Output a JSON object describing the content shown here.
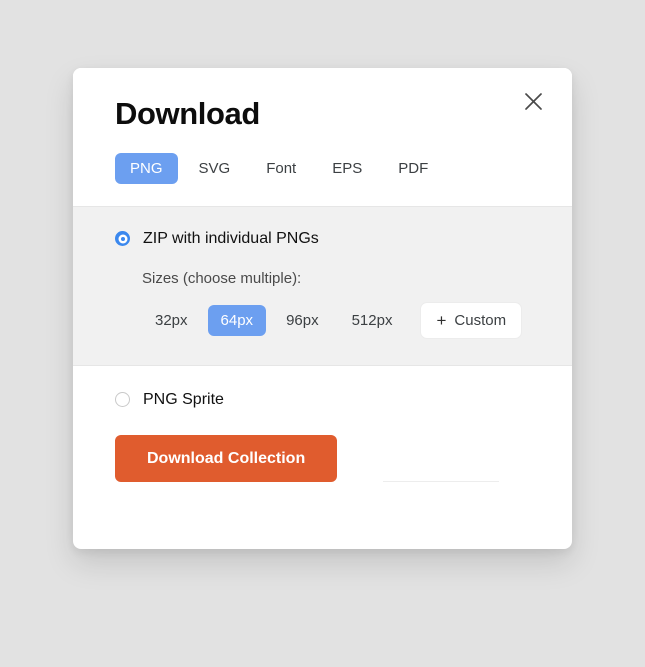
{
  "page": {
    "background_color": "#e2e2e2"
  },
  "modal": {
    "title": "Download",
    "close_icon": "close-icon",
    "accent_blue": "#6c9ff0",
    "radio_blue": "#3b88ee",
    "action_orange": "#e05c2e",
    "panel_gray": "#f1f1f1"
  },
  "format_tabs": [
    {
      "label": "PNG",
      "active": true
    },
    {
      "label": "SVG",
      "active": false
    },
    {
      "label": "Font",
      "active": false
    },
    {
      "label": "EPS",
      "active": false
    },
    {
      "label": "PDF",
      "active": false
    }
  ],
  "options": {
    "zip": {
      "label": "ZIP with individual PNGs",
      "selected": true
    },
    "sizes_caption": "Sizes (choose multiple):",
    "sizes": [
      {
        "label": "32px",
        "selected": false
      },
      {
        "label": "64px",
        "selected": true
      },
      {
        "label": "96px",
        "selected": false
      },
      {
        "label": "512px",
        "selected": false
      }
    ],
    "custom": {
      "plus": "+",
      "label": "Custom"
    },
    "sprite": {
      "label": "PNG Sprite",
      "selected": false
    }
  },
  "actions": {
    "download_label": "Download Collection"
  }
}
